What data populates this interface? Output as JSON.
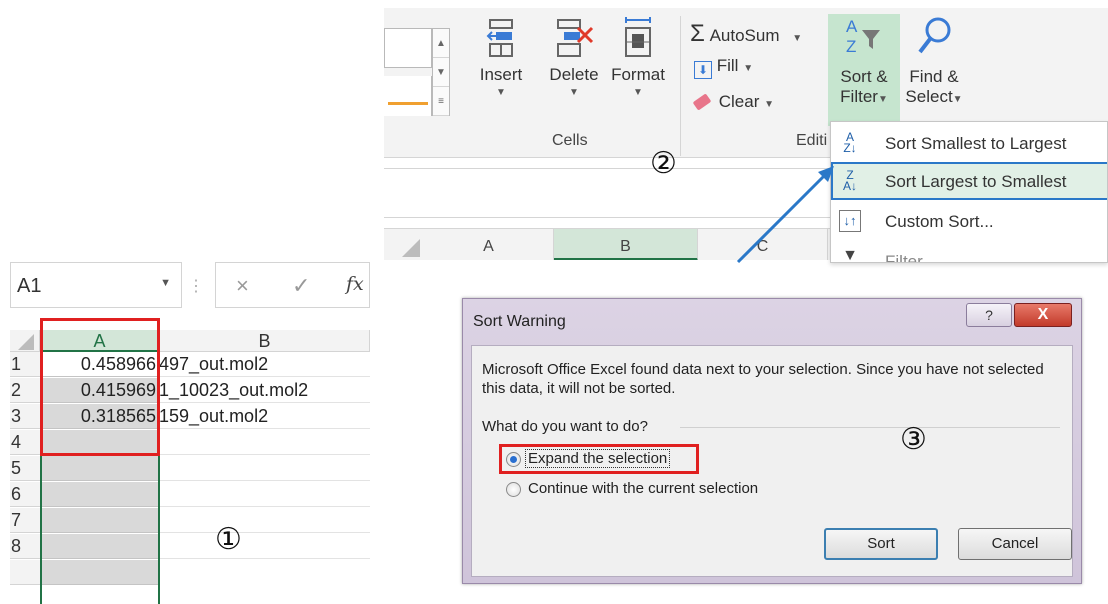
{
  "ribbon": {
    "buttons": {
      "insert": {
        "label": "Insert"
      },
      "delete": {
        "label": "Delete"
      },
      "format": {
        "label": "Format"
      },
      "autosum": {
        "label": "AutoSum"
      },
      "fill": {
        "label": "Fill"
      },
      "clear": {
        "label": "Clear"
      },
      "sort_filter": {
        "line1": "Sort &",
        "line2": "Filter"
      },
      "find_select": {
        "line1": "Find &",
        "line2": "Select"
      }
    },
    "groups": {
      "cells": "Cells",
      "editing": "Editi"
    },
    "columns": [
      "A",
      "B",
      "C"
    ],
    "selected_column": "B"
  },
  "sort_menu": {
    "items": [
      {
        "label": "Sort Smallest to Largest",
        "icon": "sort-ascending-icon"
      },
      {
        "label": "Sort Largest to Smallest",
        "icon": "sort-descending-icon",
        "highlighted": true
      },
      {
        "label": "Custom Sort...",
        "icon": "custom-sort-icon"
      },
      {
        "label": "Filter",
        "icon": "filter-icon"
      }
    ]
  },
  "steps": {
    "one": "①",
    "two": "②",
    "three": "③"
  },
  "sheet": {
    "name_box": "A1",
    "formula_icons": {
      "cancel": "×",
      "enter": "✓",
      "fx": "fx"
    },
    "columns": [
      "A",
      "B"
    ],
    "rows": [
      {
        "row": "1",
        "a": "0.458966",
        "b": "497_out.mol2"
      },
      {
        "row": "2",
        "a": "0.415969",
        "b": "1_10023_out.mol2"
      },
      {
        "row": "3",
        "a": "0.318565",
        "b": "159_out.mol2"
      },
      {
        "row": "4",
        "a": "",
        "b": ""
      },
      {
        "row": "5",
        "a": "",
        "b": ""
      },
      {
        "row": "6",
        "a": "",
        "b": ""
      },
      {
        "row": "7",
        "a": "",
        "b": ""
      },
      {
        "row": "8",
        "a": "",
        "b": ""
      }
    ]
  },
  "dialog": {
    "title": "Sort Warning",
    "help": "?",
    "close": "X",
    "message": "Microsoft Office Excel found data next to your selection.  Since you have not selected this data, it will not be sorted.",
    "question": "What do you want to do?",
    "options": [
      {
        "label": "Expand the selection",
        "checked": true
      },
      {
        "label": "Continue with the current selection",
        "checked": false
      }
    ],
    "sort_button": "Sort",
    "cancel_button": "Cancel"
  },
  "colors": {
    "excel_green": "#217346",
    "highlight_red": "#e02020",
    "menu_blue": "#2a78c8"
  }
}
